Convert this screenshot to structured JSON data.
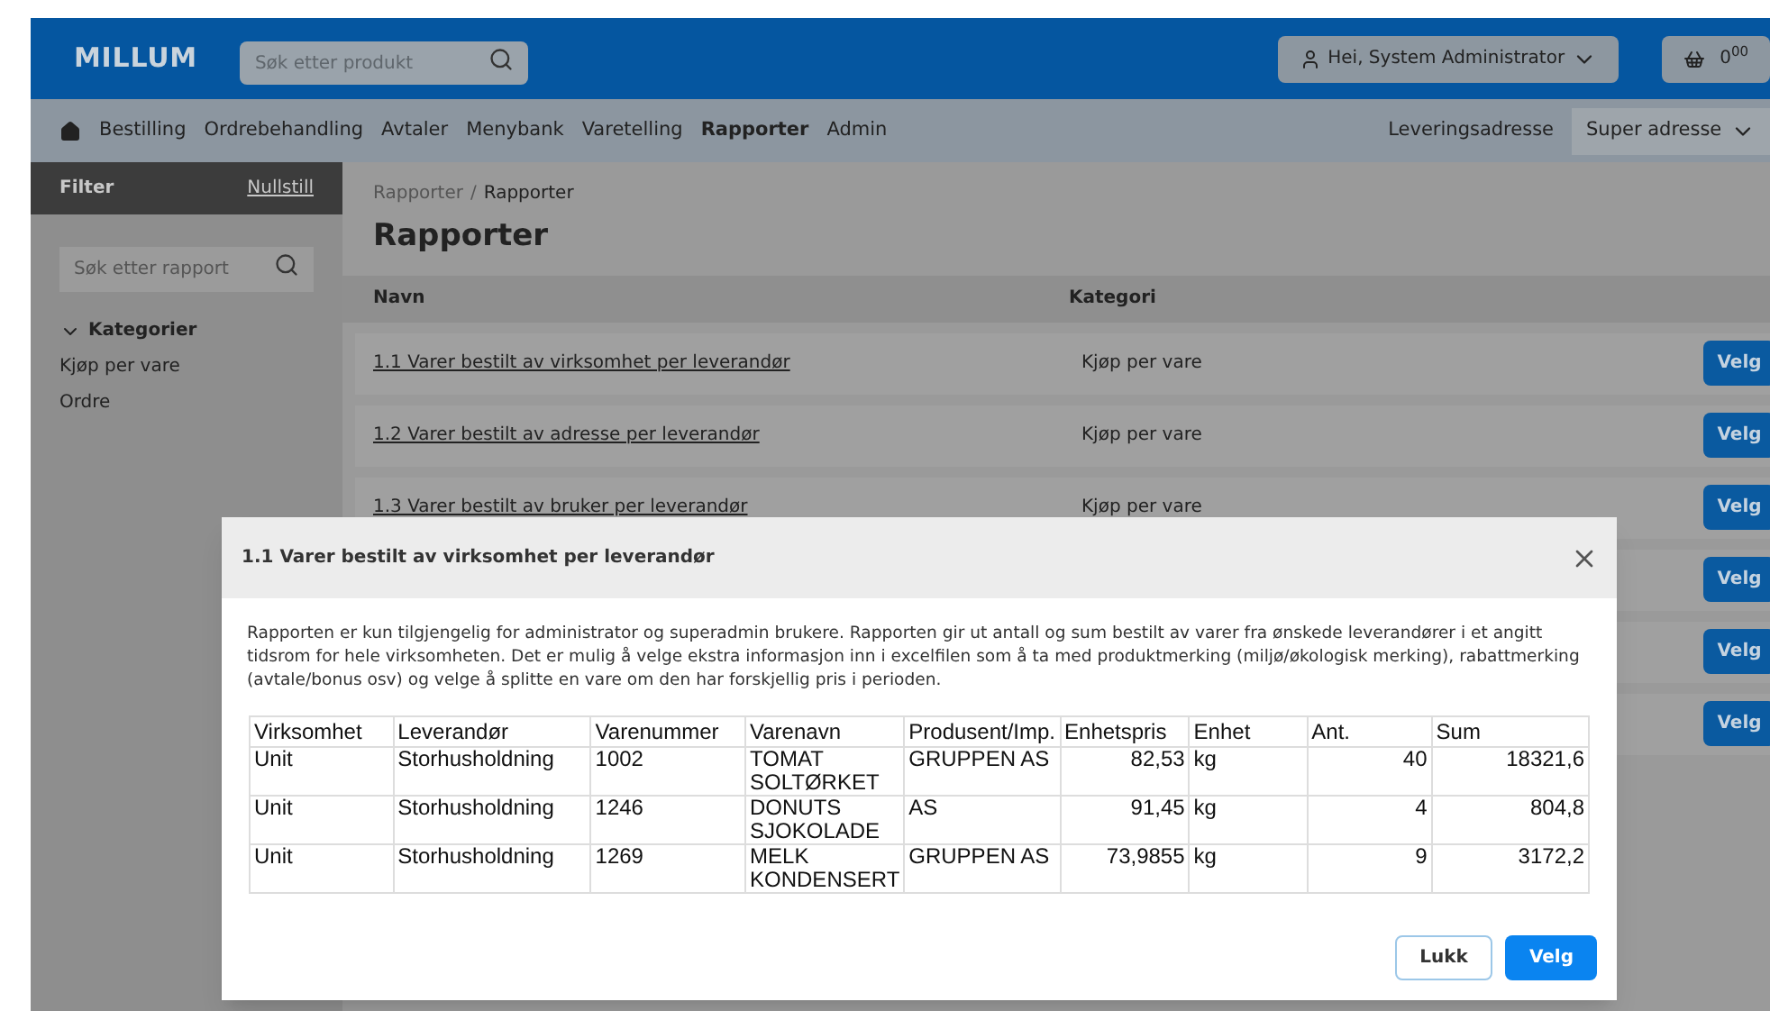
{
  "header": {
    "logo": "MILLUM",
    "search": {
      "placeholder": "Søk etter produkt"
    },
    "user": "Hei, System Administrator",
    "cart": "0$^{00}$"
  },
  "nav": {
    "items": [
      {
        "label": "Bestilling",
        "selected": false
      },
      {
        "label": "Ordrebehandling",
        "selected": false
      },
      {
        "label": "Avtaler",
        "selected": false
      },
      {
        "label": "Menybank",
        "selected": false
      },
      {
        "label": "Varetelling",
        "selected": false
      },
      {
        "label": "Rapporter",
        "selected": true
      },
      {
        "label": "Admin",
        "selected": false
      }
    ],
    "delivery_label": "Leveringsadresse",
    "delivery_value": "Super adresse"
  },
  "sidebar": {
    "title": "Filter",
    "reset": "Nullstill",
    "search": {
      "placeholder": "Søk etter rapport"
    },
    "group": {
      "label": "Kategorier",
      "expanded": true,
      "items": [
        "Kjøp per vare",
        "Ordre"
      ]
    }
  },
  "breadcrumb": [
    "Rapporter",
    "/",
    "Rapporter"
  ],
  "title": "Rapporter",
  "table": {
    "columns": [
      "Navn",
      "Kategori"
    ],
    "rows": [
      {
        "name": "1.1 Varer bestilt av virksomhet per leverandør",
        "category": "Kjøp per vare",
        "button": "Velg"
      },
      {
        "name": "1.2 Varer bestilt av adresse per leverandør",
        "category": "Kjøp per vare",
        "button": "Velg"
      },
      {
        "name": "1.3 Varer bestilt av bruker per leverandør",
        "category": "Kjøp per vare",
        "button": "Velg"
      },
      {
        "button": "Velg"
      },
      {
        "button": "Velg"
      },
      {
        "button": "Velg"
      }
    ]
  },
  "modal": {
    "title": "1.1 Varer bestilt av virksomhet per leverandør",
    "description": "Rapporten er kun tilgjengelig for administrator og superadmin brukere. Rapporten gir ut antall og sum bestilt av varer fra ønskede leverandører i et angitt tidsrom for hele virksomheten. Det er mulig å velge ekstra informasjon inn i excelfilen som å ta med produktmerking (miljø/økologisk merking), rabattmerking (avtale/bonus osv) og velge å splitte en vare om den har forskjellig pris i perioden.",
    "sample": {
      "columns": [
        "Virksomhet",
        "Leverandør",
        "Varenummer",
        "Varenavn",
        "Produsent/Imp.",
        "Enhetspris",
        "Enhet",
        "Ant.",
        "Sum"
      ],
      "rows": [
        [
          "Unit",
          "Storhusholdning",
          "1002",
          "TOMAT SOLTØRKET",
          "GRUPPEN AS",
          "82,53",
          "kg",
          "40",
          "18321,6"
        ],
        [
          "Unit",
          "Storhusholdning",
          "1246",
          "DONUTS SJOKOLADE",
          "AS",
          "91,45",
          "kg",
          "4",
          "804,8"
        ],
        [
          "Unit",
          "Storhusholdning",
          "1269",
          "MELK KONDENSERT",
          "GRUPPEN AS",
          "73,9855",
          "kg",
          "9",
          "3172,2"
        ]
      ]
    },
    "buttons": [
      {
        "label": "Lukk",
        "kind": "secondary"
      },
      {
        "label": "Velg",
        "kind": "primary"
      }
    ]
  }
}
